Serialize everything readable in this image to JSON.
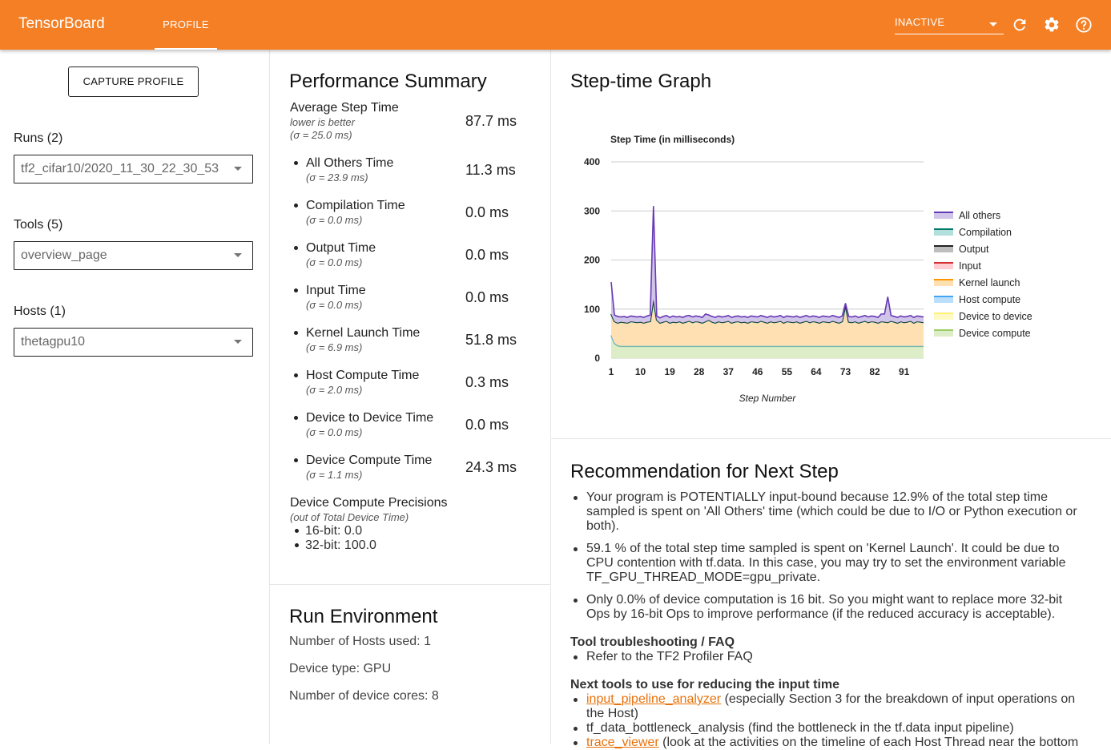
{
  "header": {
    "brand": "TensorBoard",
    "active_tab": "PROFILE",
    "status_select": "INACTIVE",
    "icons": [
      "refresh-icon",
      "settings-icon",
      "help-icon"
    ]
  },
  "sidebar": {
    "capture_button": "CAPTURE PROFILE",
    "runs_label": "Runs (2)",
    "runs_value": "tf2_cifar10/2020_11_30_22_30_53",
    "tools_label": "Tools (5)",
    "tools_value": "overview_page",
    "hosts_label": "Hosts (1)",
    "hosts_value": "thetagpu10"
  },
  "performance_summary": {
    "title": "Performance Summary",
    "average": {
      "name": "Average Step Time",
      "note": "lower is better",
      "sigma": "(σ = 25.0 ms)",
      "value": "87.7 ms"
    },
    "metrics": [
      {
        "name": "All Others Time",
        "sigma": "(σ = 23.9 ms)",
        "value": "11.3 ms"
      },
      {
        "name": "Compilation Time",
        "sigma": "(σ = 0.0 ms)",
        "value": "0.0 ms"
      },
      {
        "name": "Output Time",
        "sigma": "(σ = 0.0 ms)",
        "value": "0.0 ms"
      },
      {
        "name": "Input Time",
        "sigma": "(σ = 0.0 ms)",
        "value": "0.0 ms"
      },
      {
        "name": "Kernel Launch Time",
        "sigma": "(σ = 6.9 ms)",
        "value": "51.8 ms"
      },
      {
        "name": "Host Compute Time",
        "sigma": "(σ = 2.0 ms)",
        "value": "0.3 ms"
      },
      {
        "name": "Device to Device Time",
        "sigma": "(σ = 0.0 ms)",
        "value": "0.0 ms"
      },
      {
        "name": "Device Compute Time",
        "sigma": "(σ = 1.1 ms)",
        "value": "24.3 ms"
      }
    ],
    "precisions_title": "Device Compute Precisions",
    "precisions_note": "(out of Total Device Time)",
    "precisions": [
      "16-bit: 0.0",
      "32-bit: 100.0"
    ]
  },
  "run_environment": {
    "title": "Run Environment",
    "hosts_used": "Number of Hosts used: 1",
    "device_type": "Device type: GPU",
    "device_cores": "Number of device cores: 8"
  },
  "step_graph": {
    "card_title": "Step-time Graph"
  },
  "chart_data": {
    "type": "area",
    "title": "Step Time (in milliseconds)",
    "xlabel": "Step Number",
    "ylabel": "",
    "xlim": [
      1,
      97
    ],
    "ylim": [
      0,
      400
    ],
    "x_ticks": [
      "1",
      "10",
      "19",
      "28",
      "37",
      "46",
      "55",
      "64",
      "73",
      "82",
      "91"
    ],
    "y_ticks": [
      "0",
      "100",
      "200",
      "300",
      "400"
    ],
    "legend_position": "right",
    "series": [
      {
        "name": "All others",
        "color": "#673ab7",
        "fill": "#d1c4e9"
      },
      {
        "name": "Compilation",
        "color": "#00796b",
        "fill": "#b2dfdb"
      },
      {
        "name": "Output",
        "color": "#212121",
        "fill": "#bdbdbd"
      },
      {
        "name": "Input",
        "color": "#d32f2f",
        "fill": "#ffcdd2"
      },
      {
        "name": "Kernel launch",
        "color": "#ff9800",
        "fill": "#ffe0b2"
      },
      {
        "name": "Host compute",
        "color": "#42a5f5",
        "fill": "#bbdefb"
      },
      {
        "name": "Device to device",
        "color": "#fff176",
        "fill": "#fff9c4"
      },
      {
        "name": "Device compute",
        "color": "#9ccc65",
        "fill": "#dcedc8"
      }
    ],
    "device_compute": [
      46,
      30,
      25,
      24,
      24,
      24,
      24,
      24,
      24,
      24,
      24,
      24,
      24,
      24,
      24,
      24,
      24,
      24,
      24,
      24,
      24,
      24,
      24,
      24,
      24,
      24,
      24,
      24,
      24,
      24,
      24,
      24,
      24,
      24,
      24,
      24,
      24,
      24,
      24,
      24,
      24,
      24,
      24,
      24,
      24,
      24,
      24,
      24,
      24,
      24,
      24,
      24,
      24,
      24,
      24,
      24,
      24,
      24,
      24,
      24,
      24,
      24,
      24,
      24,
      24,
      24,
      24,
      24,
      24,
      24,
      24,
      24,
      24,
      24,
      24,
      24,
      24,
      24,
      24,
      24,
      24,
      24,
      24,
      24,
      24,
      24,
      24,
      24,
      24,
      24,
      24,
      24,
      24,
      24,
      24,
      24,
      24
    ],
    "host_compute_top": [
      47,
      31,
      26,
      25,
      25,
      25,
      25,
      25,
      25,
      25,
      25,
      25,
      25,
      25,
      25,
      25,
      25,
      25,
      25,
      25,
      25,
      25,
      25,
      25,
      25,
      25,
      25,
      25,
      25,
      25,
      25,
      25,
      25,
      25,
      25,
      25,
      25,
      25,
      25,
      25,
      25,
      25,
      25,
      25,
      25,
      25,
      25,
      25,
      25,
      25,
      25,
      25,
      25,
      25,
      25,
      25,
      25,
      25,
      25,
      25,
      25,
      25,
      25,
      25,
      25,
      25,
      25,
      25,
      25,
      25,
      25,
      25,
      25,
      25,
      25,
      25,
      25,
      25,
      25,
      25,
      25,
      25,
      25,
      25,
      25,
      25,
      25,
      25,
      25,
      25,
      25,
      25,
      25,
      25,
      25,
      25,
      25
    ],
    "kernel_launch_top": [
      90,
      75,
      72,
      74,
      73,
      72,
      75,
      74,
      73,
      74,
      72,
      74,
      75,
      120,
      78,
      72,
      74,
      76,
      72,
      74,
      73,
      75,
      72,
      74,
      76,
      73,
      75,
      74,
      72,
      75,
      78,
      74,
      72,
      75,
      73,
      74,
      76,
      72,
      74,
      75,
      73,
      74,
      72,
      75,
      74,
      73,
      76,
      74,
      72,
      75,
      73,
      74,
      76,
      72,
      75,
      74,
      73,
      75,
      72,
      74,
      76,
      73,
      75,
      74,
      72,
      75,
      74,
      73,
      76,
      74,
      72,
      75,
      108,
      74,
      73,
      75,
      72,
      74,
      76,
      73,
      75,
      74,
      72,
      75,
      74,
      73,
      76,
      74,
      72,
      75,
      73,
      74,
      76,
      72,
      75,
      74,
      73
    ],
    "all_others_top": [
      155,
      88,
      85,
      84,
      85,
      83,
      86,
      85,
      84,
      85,
      83,
      86,
      88,
      310,
      86,
      82,
      85,
      87,
      83,
      86,
      84,
      85,
      83,
      86,
      87,
      84,
      86,
      85,
      83,
      90,
      88,
      85,
      83,
      86,
      84,
      85,
      87,
      83,
      85,
      86,
      84,
      85,
      83,
      86,
      85,
      84,
      87,
      85,
      83,
      86,
      84,
      85,
      87,
      83,
      86,
      85,
      84,
      86,
      83,
      85,
      87,
      84,
      86,
      85,
      83,
      86,
      85,
      84,
      87,
      85,
      83,
      86,
      112,
      85,
      84,
      86,
      83,
      85,
      87,
      84,
      86,
      85,
      83,
      90,
      90,
      125,
      87,
      85,
      83,
      86,
      84,
      85,
      87,
      83,
      86,
      85,
      84
    ]
  },
  "recommendation": {
    "title": "Recommendation for Next Step",
    "bullets": [
      [
        "Your program is POTENTIALLY input-bound because 12.9% of the total step time",
        "sampled is spent on 'All Others' time (which could be due to I/O or Python execution or",
        "both)."
      ],
      [
        "59.1 % of the total step time sampled is spent on 'Kernel Launch'. It could be due to",
        "CPU contention with tf.data. In this case, you may try to set the environment variable",
        "TF_GPU_THREAD_MODE=gpu_private."
      ],
      [
        "Only 0.0% of device computation is 16 bit. So you might want to replace more 32-bit",
        "Ops by 16-bit Ops to improve performance (if the reduced accuracy is acceptable)."
      ]
    ],
    "faq_heading": "Tool troubleshooting / FAQ",
    "faq_item": "Refer to the TF2 Profiler FAQ",
    "next_heading": "Next tools to use for reducing the input time",
    "next_tools": [
      {
        "link": "input_pipeline_analyzer",
        "text": " (especially Section 3 for the breakdown of input operations on",
        "text2": "the Host)"
      },
      {
        "link": "",
        "text": "tf_data_bottleneck_analysis (find the bottleneck in the tf.data input pipeline)",
        "text2": ""
      },
      {
        "link": "trace_viewer",
        "text": " (look at the activities on the timeline of each Host Thread near the bottom",
        "text2": ""
      }
    ]
  }
}
